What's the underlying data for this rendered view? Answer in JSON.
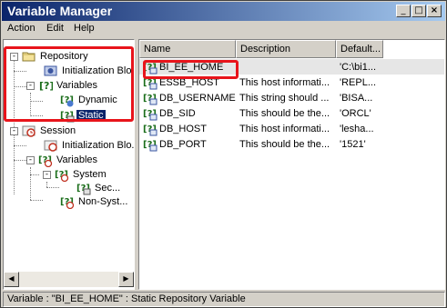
{
  "window": {
    "title": "Variable Manager"
  },
  "menu": {
    "items": [
      "Action",
      "Edit",
      "Help"
    ]
  },
  "tree": {
    "repository": "Repository",
    "init_blocks": "Initialization Blo...",
    "variables": "Variables",
    "dynamic": "Dynamic",
    "static": "Static",
    "session": "Session",
    "session_init_blocks": "Initialization Blo...",
    "session_variables": "Variables",
    "system": "System",
    "sec": "Sec...",
    "non_system": "Non-Syst..."
  },
  "list": {
    "columns": [
      "Name",
      "Description",
      "Default..."
    ],
    "rows": [
      {
        "name": "BI_EE_HOME",
        "description": "",
        "default": "'C:\\bi1..."
      },
      {
        "name": "ESSB_HOST",
        "description": "This host informati...",
        "default": "'REPL..."
      },
      {
        "name": "DB_USERNAME",
        "description": "This string should ...",
        "default": "'BISA..."
      },
      {
        "name": "DB_SID",
        "description": "This should be the...",
        "default": "'ORCL'"
      },
      {
        "name": "DB_HOST",
        "description": "This host informati...",
        "default": "'lesha..."
      },
      {
        "name": "DB_PORT",
        "description": "This should be the...",
        "default": "'1521'"
      }
    ]
  },
  "status": {
    "text": "Variable : \"BI_EE_HOME\" : Static Repository Variable"
  },
  "colors": {
    "highlight": "#e8141b",
    "selection": "#0a246a",
    "titlebar": "#0a246a"
  },
  "icons": {
    "folder": "folder-icon",
    "init_block": "init-block-icon",
    "variable": "variable-icon",
    "session": "session-icon"
  }
}
